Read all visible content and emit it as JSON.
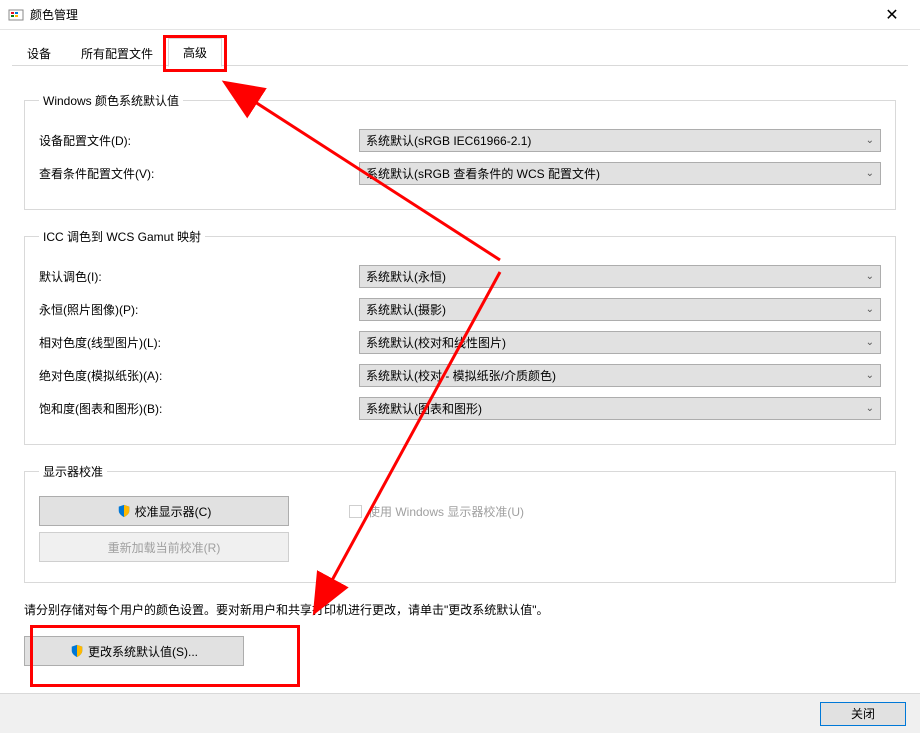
{
  "window": {
    "title": "颜色管理"
  },
  "tabs": {
    "devices": "设备",
    "profiles": "所有配置文件",
    "advanced": "高级"
  },
  "group1": {
    "legend": "Windows 颜色系统默认值",
    "device_profile_label": "设备配置文件(D):",
    "device_profile_value": "系统默认(sRGB IEC61966-2.1)",
    "viewing_profile_label": "查看条件配置文件(V):",
    "viewing_profile_value": "系统默认(sRGB 查看条件的 WCS 配置文件)"
  },
  "group2": {
    "legend": "ICC 调色到 WCS Gamut 映射",
    "default_intent_label": "默认调色(I):",
    "default_intent_value": "系统默认(永恒)",
    "perceptual_label": "永恒(照片图像)(P):",
    "perceptual_value": "系统默认(摄影)",
    "relative_label": "相对色度(线型图片)(L):",
    "relative_value": "系统默认(校对和线性图片)",
    "absolute_label": "绝对色度(模拟纸张)(A):",
    "absolute_value": "系统默认(校对 - 模拟纸张/介质颜色)",
    "saturation_label": "饱和度(图表和图形)(B):",
    "saturation_value": "系统默认(图表和图形)"
  },
  "group3": {
    "legend": "显示器校准",
    "calibrate_btn": "校准显示器(C)",
    "use_windows_calib": "使用 Windows 显示器校准(U)",
    "reload_btn": "重新加载当前校准(R)"
  },
  "note_text": "请分别存储对每个用户的颜色设置。要对新用户和共享打印机进行更改，请单击\"更改系统默认值\"。",
  "change_defaults_btn": "更改系统默认值(S)...",
  "footer": {
    "close": "关闭"
  }
}
